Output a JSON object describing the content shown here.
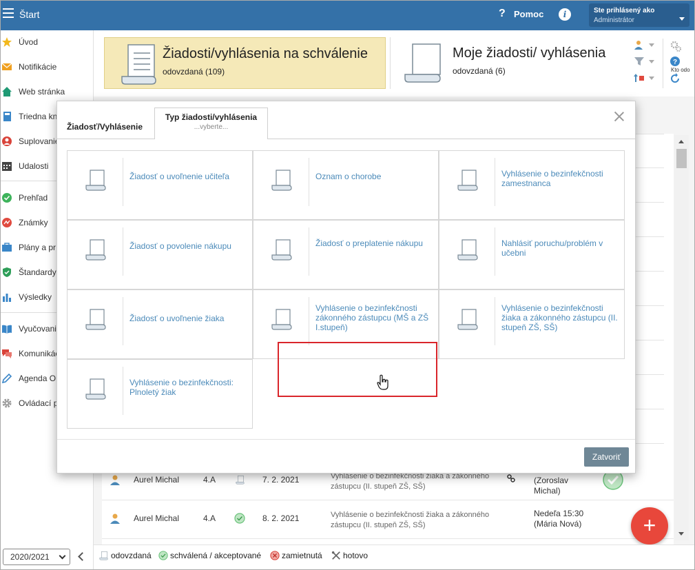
{
  "app": {
    "title": "Štart",
    "help_label": "Pomoc",
    "user_line1": "Ste prihlásený ako",
    "user_line2": "Administrátor"
  },
  "sidebar": {
    "items": [
      {
        "label": "Úvod",
        "icon": "star-icon"
      },
      {
        "label": "Notifikácie",
        "icon": "envelope-icon"
      },
      {
        "label": "Web stránka",
        "icon": "home-icon"
      },
      {
        "label": "Triedna kni",
        "icon": "book-icon"
      },
      {
        "label": "Suplovanie",
        "icon": "person-red-icon"
      },
      {
        "label": "Udalosti",
        "icon": "calendar-icon"
      },
      {
        "label": "Prehľad",
        "icon": "check-circle-icon"
      },
      {
        "label": "Známky",
        "icon": "grade-icon"
      },
      {
        "label": "Plány a pr",
        "icon": "briefcase-icon"
      },
      {
        "label": "Štandardy",
        "icon": "shield-icon"
      },
      {
        "label": "Výsledky",
        "icon": "bar-chart-icon"
      },
      {
        "label": "Vyučovanie",
        "icon": "open-book-icon"
      },
      {
        "label": "Komunikácia",
        "icon": "chat-icon"
      },
      {
        "label": "Agenda O",
        "icon": "pen-icon"
      },
      {
        "label": "Ovládací p",
        "icon": "gear-icon"
      }
    ],
    "school_year": "2020/2021"
  },
  "cards": {
    "pending": {
      "title": "Žiadosti/vyhlásenia na schválenie",
      "subtitle": "odovzdaná (109)"
    },
    "mine": {
      "title": "Moje žiadosti/ vyhlásenia",
      "subtitle": "odovzdaná (6)"
    },
    "kto_label": "Kto odo"
  },
  "background_rows": [
    {
      "name": "Aurel Michal",
      "class": "4.A",
      "date": "7. 2. 2021",
      "desc": "Vyhlásenie o bezinfekčnosti žiaka a zákonného zástupcu (II. stupeň ZŠ, SŠ)",
      "who": "(Zoroslav Michal)"
    },
    {
      "name": "Aurel Michal",
      "class": "4.A",
      "date": "8. 2. 2021",
      "desc": "Vyhlásenie o bezinfekčnosti žiaka a zákonného zástupcu (II. stupeň ZŠ, SŠ)",
      "when": "Nedeľa 15:30",
      "who": "(Mária Nová)"
    }
  ],
  "legend": {
    "submitted": "odovzdaná",
    "approved": "schválená / akceptované",
    "rejected": "zamietnutá",
    "done": "hotovo"
  },
  "modal": {
    "tab1": "Žiadosť/Vyhlásenie",
    "tab2_title": "Typ žiadosti/vyhlásenia",
    "tab2_hint": "...vyberte...",
    "close_button": "Zatvoriť",
    "types": [
      "Žiadosť o uvoľnenie učiteľa",
      "Oznam o chorobe",
      "Vyhlásenie o bezinfekčnosti zamestnanca",
      "Žiadosť o povolenie nákupu",
      "Žiadosť o preplatenie nákupu",
      "Nahlásiť poruchu/problém v učebni",
      "Žiadosť o uvoľnenie žiaka",
      "Vyhlásenie o bezinfekčnosti zákonného zástupcu (MŠ a ZŠ I.stupeň)",
      "Vyhlásenie o bezinfekčnosti žiaka a zákonného zástupcu (II. stupeň ZŠ, SŠ)",
      "Vyhlásenie o bezinfekčnosti: Plnoletý žiak"
    ]
  },
  "colors": {
    "topbar": "#3471a8",
    "accent_link": "#4b8ab9",
    "pending_card": "#f5e9b8",
    "highlight": "#d9252a",
    "fab": "#e8473b"
  }
}
